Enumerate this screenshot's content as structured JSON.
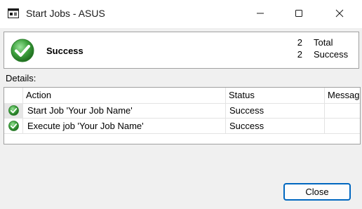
{
  "window": {
    "title": "Start Jobs - ASUS",
    "app_icon": "window-app-icon",
    "controls": {
      "minimize_icon": "minimize-icon",
      "maximize_icon": "maximize-icon",
      "close_icon": "close-icon"
    }
  },
  "summary": {
    "status_icon": "success-check-icon",
    "status": "Success",
    "total_count": "2",
    "total_label": "Total",
    "success_count": "2",
    "success_label": "Success"
  },
  "details": {
    "label": "Details:",
    "columns": [
      "Action",
      "Status",
      "Message"
    ],
    "rows": [
      {
        "icon": "success-check-icon",
        "action": "Start Job 'Your Job Name'",
        "status": "Success",
        "message": ""
      },
      {
        "icon": "success-check-icon",
        "action": "Execute job 'Your Job Name'",
        "status": "Success",
        "message": ""
      }
    ]
  },
  "footer": {
    "close_label": "Close"
  },
  "colors": {
    "accent": "#0067c0",
    "success_green": "#3fa33f"
  }
}
